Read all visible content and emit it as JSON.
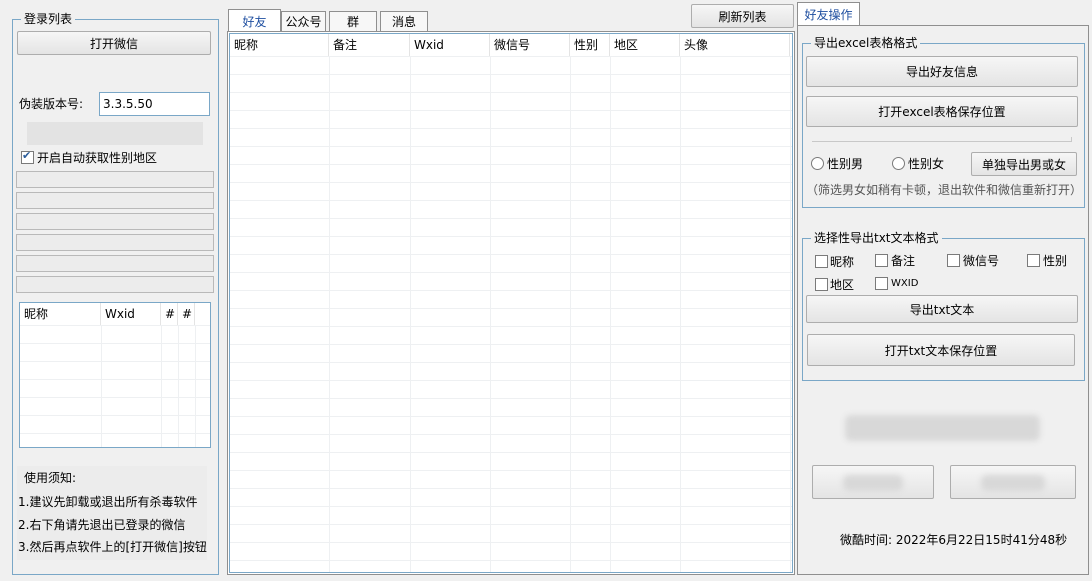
{
  "left_panel": {
    "group_title": "登录列表",
    "open_wechat_button": "打开微信",
    "fake_version_label": "伪装版本号:",
    "fake_version_value": "3.3.5.50",
    "auto_fetch_checkbox_label": "开启自动获取性别地区",
    "auto_fetch_checked": true,
    "login_table": {
      "columns": [
        "昵称",
        "Wxid",
        "#",
        "#"
      ]
    },
    "notice_title": "使用须知:",
    "notices": [
      "1.建议先卸载或退出所有杀毒软件",
      "2.右下角请先退出已登录的微信",
      "3.然后再点软件上的[打开微信]按钮"
    ]
  },
  "center_panel": {
    "tabs": [
      "好友",
      "公众号",
      "群",
      "消息"
    ],
    "active_tab": "好友",
    "refresh_button": "刷新列表",
    "table_columns": [
      "昵称",
      "备注",
      "Wxid",
      "微信号",
      "性别",
      "地区",
      "头像"
    ]
  },
  "right_panel": {
    "tab_label": "好友操作",
    "excel_group_title": "导出excel表格格式",
    "export_friends_button": "导出好友信息",
    "open_excel_location_button": "打开excel表格保存位置",
    "radio_male_label": "性别男",
    "radio_female_label": "性别女",
    "export_gender_button": "单独导出男或女",
    "filter_hint": "（筛选男女如稍有卡顿，退出软件和微信重新打开）",
    "txt_group_title": "选择性导出txt文本格式",
    "txt_checkboxes": [
      "昵称",
      "备注",
      "微信号",
      "性别",
      "地区",
      "WXID"
    ],
    "export_txt_button": "导出txt文本",
    "open_txt_location_button": "打开txt文本保存位置",
    "status_time": "微酷时间: 2022年6月22日15时41分48秒"
  },
  "colors": {
    "border_blue": "#7aa7c7",
    "tab_text_active": "#1f4fa0",
    "window_bg": "#f0f0f0"
  }
}
